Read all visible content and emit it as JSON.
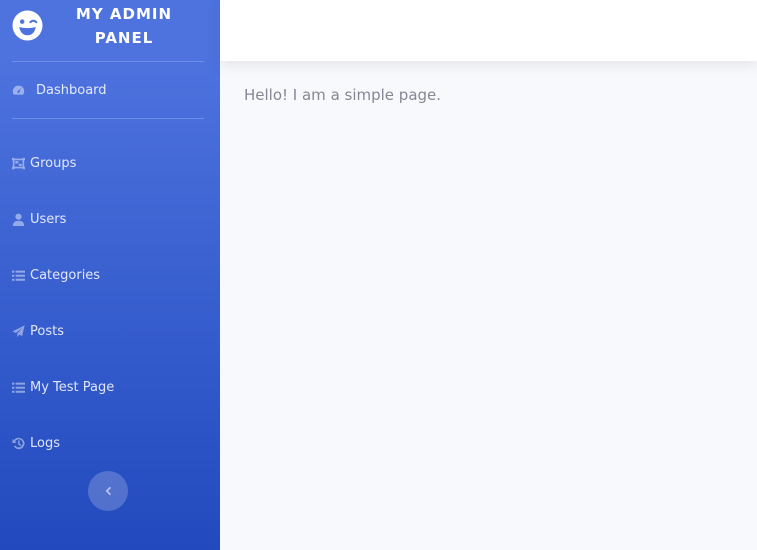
{
  "brand": {
    "title_line1": "MY ADMIN",
    "title_line2": "PANEL",
    "icon": "grin-wink-icon"
  },
  "nav": {
    "dashboard": {
      "label": "Dashboard",
      "icon": "tachometer-icon"
    },
    "items": [
      {
        "label": "Groups",
        "icon": "object-group-icon"
      },
      {
        "label": "Users",
        "icon": "user-icon"
      },
      {
        "label": "Categories",
        "icon": "list-icon"
      },
      {
        "label": "Posts",
        "icon": "paper-plane-icon"
      },
      {
        "label": "My Test Page",
        "icon": "list-icon"
      },
      {
        "label": "Logs",
        "icon": "history-icon"
      }
    ],
    "toggle_icon": "chevron-left-icon"
  },
  "main": {
    "text": "Hello! I am a simple page."
  },
  "colors": {
    "sidebar_top": "#4e73df",
    "sidebar_bottom": "#224abe",
    "page_bg": "#f8f9fc",
    "text": "#858796"
  }
}
